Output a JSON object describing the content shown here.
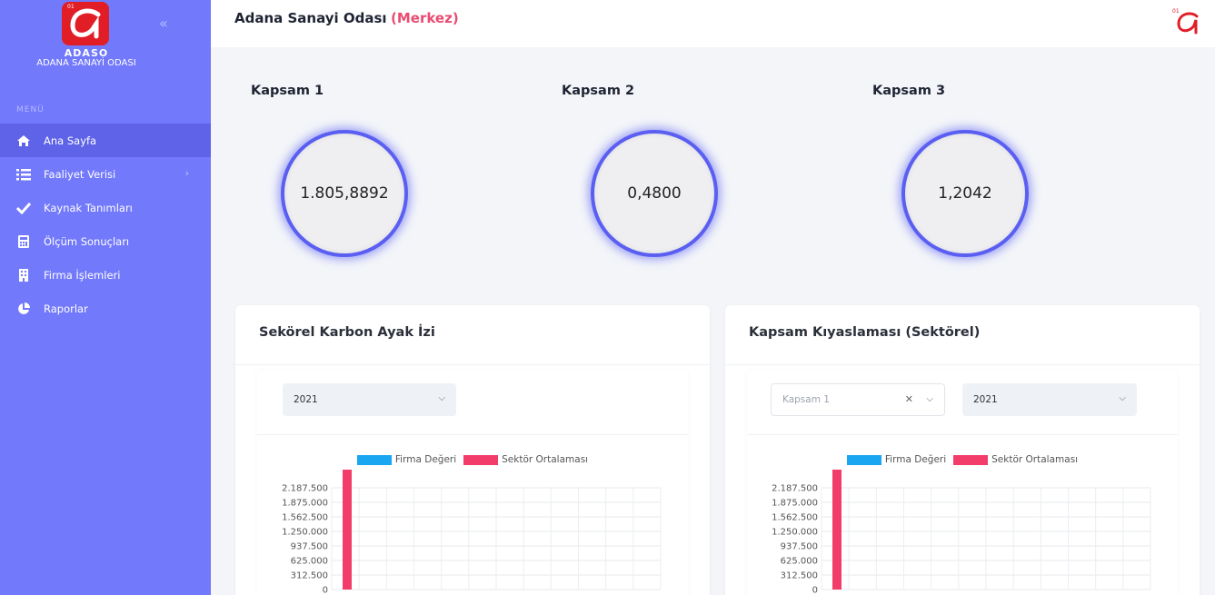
{
  "app": {
    "logo_text": "ADASO",
    "logo_sub": "ADANA SANAYİ ODASI",
    "logo_number": "01"
  },
  "header": {
    "title": "Adana Sanayi Odası",
    "subtitle": "(Merkez)"
  },
  "sidebar": {
    "caption": "MENÜ",
    "items": [
      {
        "label": "Ana Sayfa",
        "icon": "home-icon",
        "active": true
      },
      {
        "label": "Faaliyet Verisi",
        "icon": "list-icon",
        "has_submenu": true
      },
      {
        "label": "Kaynak Tanımları",
        "icon": "check-icon"
      },
      {
        "label": "Ölçüm Sonuçları",
        "icon": "calculator-icon"
      },
      {
        "label": "Firma İşlemleri",
        "icon": "building-icon"
      },
      {
        "label": "Raporlar",
        "icon": "pie-chart-icon"
      }
    ]
  },
  "scopes": [
    {
      "title": "Kapsam 1",
      "value": "1.805,8892"
    },
    {
      "title": "Kapsam 2",
      "value": "0,4800"
    },
    {
      "title": "Kapsam 3",
      "value": "1,2042"
    }
  ],
  "cards": {
    "left": {
      "title": "Sekörel Karbon Ayak İzi",
      "year_select": "2021"
    },
    "right": {
      "title": "Kapsam Kıyaslaması (Sektörel)",
      "scope_select_placeholder": "Kapsam 1",
      "year_select": "2021"
    }
  },
  "colors": {
    "sidebar": "#7279fb",
    "accent": "#e94c72",
    "ring": "#5a5ff2",
    "firma": "#1aa6f0",
    "sektor": "#f23d6b"
  },
  "chart_data": [
    {
      "type": "bar",
      "legend": [
        "Firma Değeri",
        "Sektör Ortalaması"
      ],
      "yticks": [
        "2.187.500",
        "1.875.000",
        "1.562.500",
        "1.250.000",
        "937.500",
        "625.000",
        "312.500",
        "0"
      ],
      "ylim": [
        0,
        2187500
      ],
      "series": [
        {
          "name": "Firma Değeri",
          "values": [
            0
          ]
        },
        {
          "name": "Sektör Ortalaması",
          "values": [
            2187500
          ]
        }
      ]
    },
    {
      "type": "bar",
      "legend": [
        "Firma Değeri",
        "Sektör Ortalaması"
      ],
      "yticks": [
        "2.187.500",
        "1.875.000",
        "1.562.500",
        "1.250.000",
        "937.500",
        "625.000",
        "312.500",
        "0"
      ],
      "ylim": [
        0,
        2187500
      ],
      "series": [
        {
          "name": "Firma Değeri",
          "values": [
            0
          ]
        },
        {
          "name": "Sektör Ortalaması",
          "values": [
            2187500
          ]
        }
      ]
    }
  ]
}
